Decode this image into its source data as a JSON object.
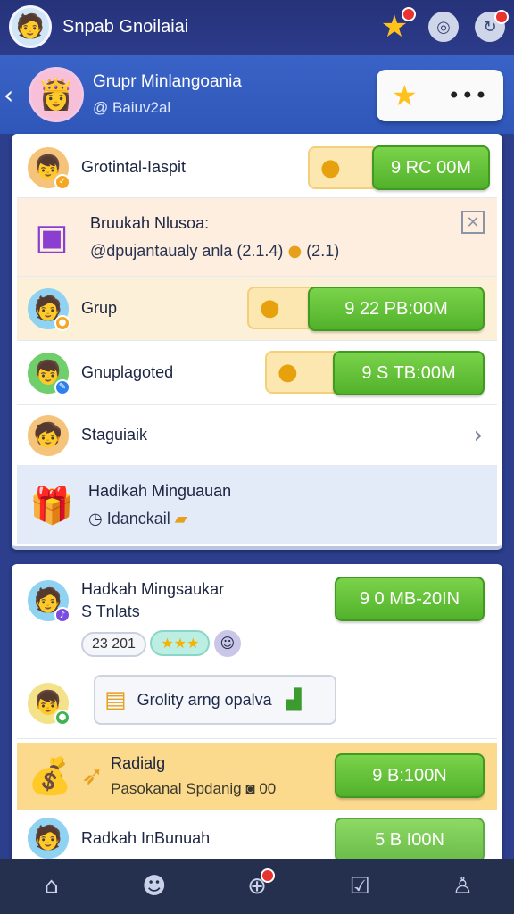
{
  "appbar": {
    "title": "Snpab Gnoilaiai",
    "icons": [
      "star-icon",
      "headset-icon",
      "refresh-icon"
    ]
  },
  "group": {
    "title": "Grupr Minlangoania",
    "subtitle": "@ Baiuv2al",
    "back_icon": "chevron-left-icon",
    "more_label": "•••"
  },
  "card1": {
    "rows": [
      {
        "label": "Grotintal-Iaspit",
        "value": "9 RC 00M"
      },
      {
        "label": "Bruukah Nlusoa:",
        "sub": "@dpujantaualy anla",
        "chip1": "(2.1.4)",
        "chip2": "(2.1)"
      },
      {
        "label": "Grup",
        "value": "9  22 PB:00M"
      },
      {
        "label": "Gnuplagoted",
        "value": "9  S TB:00M"
      },
      {
        "label": "Staguiaik"
      },
      {
        "label": "Hadikah Minguauan",
        "sub": "Idanckail"
      }
    ]
  },
  "card2": {
    "rows": [
      {
        "label": "Hadkah Mingsaukar",
        "sub": "S Tnlats",
        "chip": "23  201",
        "stars": "★★★",
        "value": "9  0 MB-20IN"
      },
      {
        "pill": "Grolity arng opalva"
      },
      {
        "label": "Radialg",
        "sub": "Pasokanal Spdanig ◙ 00",
        "value": "9  B:100N"
      },
      {
        "label": "Radkah InBunuah",
        "value": "5  B I00N"
      }
    ]
  },
  "colors": {
    "header_bg": "#2c3b8a",
    "group_bg": "#3a63c7",
    "accent_green": "#52b12b",
    "highlight_orange": "#fde7b0",
    "highlight_blue": "#e3ebf8"
  }
}
